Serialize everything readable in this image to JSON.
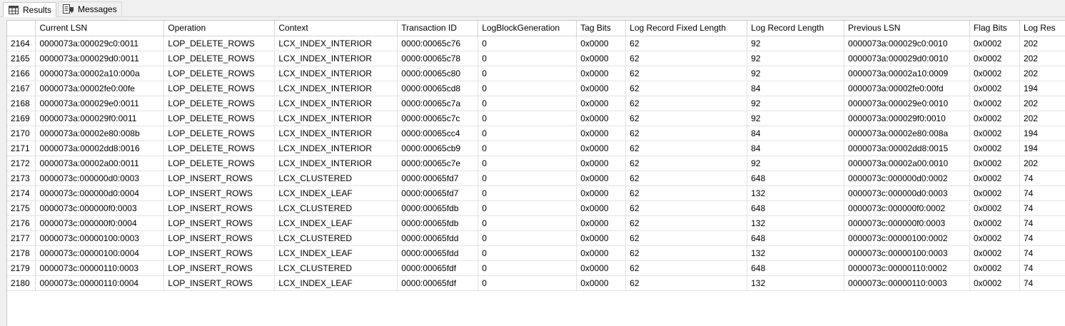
{
  "tabs": [
    {
      "label": "Results",
      "icon": "grid-icon",
      "active": true
    },
    {
      "label": "Messages",
      "icon": "messages-icon",
      "active": false
    }
  ],
  "columns": [
    "Current LSN",
    "Operation",
    "Context",
    "Transaction ID",
    "LogBlockGeneration",
    "Tag Bits",
    "Log Record Fixed Length",
    "Log Record Length",
    "Previous LSN",
    "Flag Bits",
    "Log Res"
  ],
  "rows": [
    {
      "n": "2164",
      "cells": [
        "0000073a:000029c0:0011",
        "LOP_DELETE_ROWS",
        "LCX_INDEX_INTERIOR",
        "0000:00065c76",
        "0",
        "0x0000",
        "62",
        "92",
        "0000073a:000029c0:0010",
        "0x0002",
        "202"
      ]
    },
    {
      "n": "2165",
      "cells": [
        "0000073a:000029d0:0011",
        "LOP_DELETE_ROWS",
        "LCX_INDEX_INTERIOR",
        "0000:00065c78",
        "0",
        "0x0000",
        "62",
        "92",
        "0000073a:000029d0:0010",
        "0x0002",
        "202"
      ]
    },
    {
      "n": "2166",
      "cells": [
        "0000073a:00002a10:000a",
        "LOP_DELETE_ROWS",
        "LCX_INDEX_INTERIOR",
        "0000:00065c80",
        "0",
        "0x0000",
        "62",
        "92",
        "0000073a:00002a10:0009",
        "0x0002",
        "202"
      ]
    },
    {
      "n": "2167",
      "cells": [
        "0000073a:00002fe0:00fe",
        "LOP_DELETE_ROWS",
        "LCX_INDEX_INTERIOR",
        "0000:00065cd8",
        "0",
        "0x0000",
        "62",
        "84",
        "0000073a:00002fe0:00fd",
        "0x0002",
        "194"
      ]
    },
    {
      "n": "2168",
      "cells": [
        "0000073a:000029e0:0011",
        "LOP_DELETE_ROWS",
        "LCX_INDEX_INTERIOR",
        "0000:00065c7a",
        "0",
        "0x0000",
        "62",
        "92",
        "0000073a:000029e0:0010",
        "0x0002",
        "202"
      ]
    },
    {
      "n": "2169",
      "cells": [
        "0000073a:000029f0:0011",
        "LOP_DELETE_ROWS",
        "LCX_INDEX_INTERIOR",
        "0000:00065c7c",
        "0",
        "0x0000",
        "62",
        "92",
        "0000073a:000029f0:0010",
        "0x0002",
        "202"
      ]
    },
    {
      "n": "2170",
      "cells": [
        "0000073a:00002e80:008b",
        "LOP_DELETE_ROWS",
        "LCX_INDEX_INTERIOR",
        "0000:00065cc4",
        "0",
        "0x0000",
        "62",
        "84",
        "0000073a:00002e80:008a",
        "0x0002",
        "194"
      ]
    },
    {
      "n": "2171",
      "cells": [
        "0000073a:00002dd8:0016",
        "LOP_DELETE_ROWS",
        "LCX_INDEX_INTERIOR",
        "0000:00065cb9",
        "0",
        "0x0000",
        "62",
        "84",
        "0000073a:00002dd8:0015",
        "0x0002",
        "194"
      ]
    },
    {
      "n": "2172",
      "cells": [
        "0000073a:00002a00:0011",
        "LOP_DELETE_ROWS",
        "LCX_INDEX_INTERIOR",
        "0000:00065c7e",
        "0",
        "0x0000",
        "62",
        "92",
        "0000073a:00002a00:0010",
        "0x0002",
        "202"
      ]
    },
    {
      "n": "2173",
      "cells": [
        "0000073c:000000d0:0003",
        "LOP_INSERT_ROWS",
        "LCX_CLUSTERED",
        "0000:00065fd7",
        "0",
        "0x0000",
        "62",
        "648",
        "0000073c:000000d0:0002",
        "0x0002",
        "74"
      ]
    },
    {
      "n": "2174",
      "cells": [
        "0000073c:000000d0:0004",
        "LOP_INSERT_ROWS",
        "LCX_INDEX_LEAF",
        "0000:00065fd7",
        "0",
        "0x0000",
        "62",
        "132",
        "0000073c:000000d0:0003",
        "0x0002",
        "74"
      ]
    },
    {
      "n": "2175",
      "cells": [
        "0000073c:000000f0:0003",
        "LOP_INSERT_ROWS",
        "LCX_CLUSTERED",
        "0000:00065fdb",
        "0",
        "0x0000",
        "62",
        "648",
        "0000073c:000000f0:0002",
        "0x0002",
        "74"
      ]
    },
    {
      "n": "2176",
      "cells": [
        "0000073c:000000f0:0004",
        "LOP_INSERT_ROWS",
        "LCX_INDEX_LEAF",
        "0000:00065fdb",
        "0",
        "0x0000",
        "62",
        "132",
        "0000073c:000000f0:0003",
        "0x0002",
        "74"
      ]
    },
    {
      "n": "2177",
      "cells": [
        "0000073c:00000100:0003",
        "LOP_INSERT_ROWS",
        "LCX_CLUSTERED",
        "0000:00065fdd",
        "0",
        "0x0000",
        "62",
        "648",
        "0000073c:00000100:0002",
        "0x0002",
        "74"
      ]
    },
    {
      "n": "2178",
      "cells": [
        "0000073c:00000100:0004",
        "LOP_INSERT_ROWS",
        "LCX_INDEX_LEAF",
        "0000:00065fdd",
        "0",
        "0x0000",
        "62",
        "132",
        "0000073c:00000100:0003",
        "0x0002",
        "74"
      ]
    },
    {
      "n": "2179",
      "cells": [
        "0000073c:00000110:0003",
        "LOP_INSERT_ROWS",
        "LCX_CLUSTERED",
        "0000:00065fdf",
        "0",
        "0x0000",
        "62",
        "648",
        "0000073c:00000110:0002",
        "0x0002",
        "74"
      ]
    },
    {
      "n": "2180",
      "cells": [
        "0000073c:00000110:0004",
        "LOP_INSERT_ROWS",
        "LCX_INDEX_LEAF",
        "0000:00065fdf",
        "0",
        "0x0000",
        "62",
        "132",
        "0000073c:00000110:0003",
        "0x0002",
        "74"
      ]
    }
  ]
}
